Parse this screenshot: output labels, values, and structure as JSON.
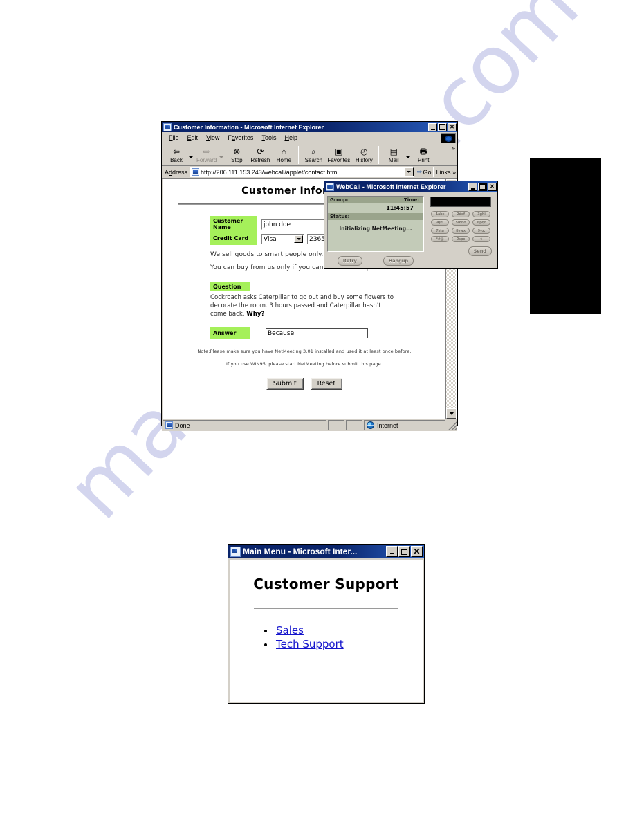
{
  "browser_window": {
    "title": "Customer Information - Microsoft Internet Explorer",
    "window_controls": {
      "minimize": "_",
      "maximize": "□",
      "close": "✕"
    },
    "menu": [
      {
        "label": "File"
      },
      {
        "label": "Edit"
      },
      {
        "label": "View"
      },
      {
        "label": "Favorites"
      },
      {
        "label": "Tools"
      },
      {
        "label": "Help"
      }
    ],
    "toolbar": [
      {
        "label": "Back",
        "icon": "back-arrow-icon",
        "glyph": "⇦",
        "disabled": false,
        "dropdown": true
      },
      {
        "label": "Forward",
        "icon": "forward-arrow-icon",
        "glyph": "⇨",
        "disabled": true,
        "dropdown": true
      },
      {
        "label": "Stop",
        "icon": "stop-icon",
        "glyph": "✖",
        "disabled": false,
        "dropdown": false
      },
      {
        "label": "Refresh",
        "icon": "refresh-icon",
        "glyph": "⭮",
        "disabled": false,
        "dropdown": false
      },
      {
        "label": "Home",
        "icon": "home-icon",
        "glyph": "⌂",
        "disabled": false,
        "dropdown": false
      },
      {
        "label": "Search",
        "icon": "search-icon",
        "glyph": "🔍",
        "disabled": false,
        "dropdown": false
      },
      {
        "label": "Favorites",
        "icon": "favorites-icon",
        "glyph": "★",
        "disabled": false,
        "dropdown": false
      },
      {
        "label": "History",
        "icon": "history-icon",
        "glyph": "◷",
        "disabled": false,
        "dropdown": false
      },
      {
        "label": "Mail",
        "icon": "mail-icon",
        "glyph": "✉",
        "disabled": false,
        "dropdown": true
      },
      {
        "label": "Print",
        "icon": "print-icon",
        "glyph": "🖶",
        "disabled": false,
        "dropdown": false
      }
    ],
    "toolbar_overflow": "»",
    "address_bar": {
      "label": "Address",
      "value": "http://206.111.153.243/webcall/applet/contact.htm",
      "placeholder": "",
      "go_label": "Go",
      "links_label": "Links",
      "links_overflow": "»"
    },
    "status_bar": {
      "left": "Done",
      "zone": "Internet"
    }
  },
  "page": {
    "title": "Customer Information",
    "fields": {
      "customer_name_label": "Customer Name",
      "customer_name_value": "john doe",
      "credit_card_label": "Credit Card",
      "credit_card_type": "Visa",
      "credit_card_options": [
        "Visa"
      ],
      "credit_card_number": "2365-2"
    },
    "paragraphs": [
      "We sell goods to smart people only.",
      "You can buy from us only if you can answer this question."
    ],
    "question_label": "Question",
    "question_text": "Cockroach asks Caterpillar to go out and buy some flowers to decorate the room.  3 hours passed and Caterpillar hasn't come back.  ",
    "question_emphasis": "Why?",
    "answer_label": "Answer",
    "answer_value": "Because",
    "notes": [
      "Note:Please make sure you have NetMeeting 3.01 installed and used it at least once before.",
      "If you use WIN95, please start NetMeeting before submit this page."
    ],
    "submit_label": "Submit",
    "reset_label": "Reset"
  },
  "webcall_window": {
    "title": "WebCall - Microsoft Internet Explorer",
    "window_controls": {
      "minimize": "_",
      "maximize": "□",
      "close": "✕"
    },
    "group_label": "Group:",
    "group_value": "",
    "time_label": "Time:",
    "time_value": "11:45:57",
    "status_label": "Status:",
    "status_value": "Initializing NetMeeting...",
    "retry_label": "Retry",
    "hangup_label": "Hangup",
    "send_label": "Send",
    "display_value": "",
    "keypad": [
      "1abc",
      "2def",
      "3ghi",
      "4jkl",
      "5mno",
      "6pqr",
      "7stu",
      "8vwx",
      "9yz.",
      "*#@",
      "0spc",
      "<-"
    ]
  },
  "main_menu_window": {
    "title": "Main Menu - Microsoft Inter...",
    "window_controls": {
      "minimize": "_",
      "maximize": "□",
      "close": "✕"
    },
    "heading": "Customer Support",
    "links": [
      {
        "label": "Sales"
      },
      {
        "label": "Tech Support"
      }
    ]
  },
  "watermark": {
    "text": "manualshive.com"
  },
  "colors": {
    "titlebar_blue": "#0a246a",
    "chrome_gray": "#d4d0c8",
    "highlight_green": "#a5f05a",
    "link_blue": "#1414cc",
    "watermark": "#b9bce4",
    "webcall_panel": "#c3cbb8",
    "webcall_header": "#9aa48c",
    "redaction": "#000000"
  }
}
